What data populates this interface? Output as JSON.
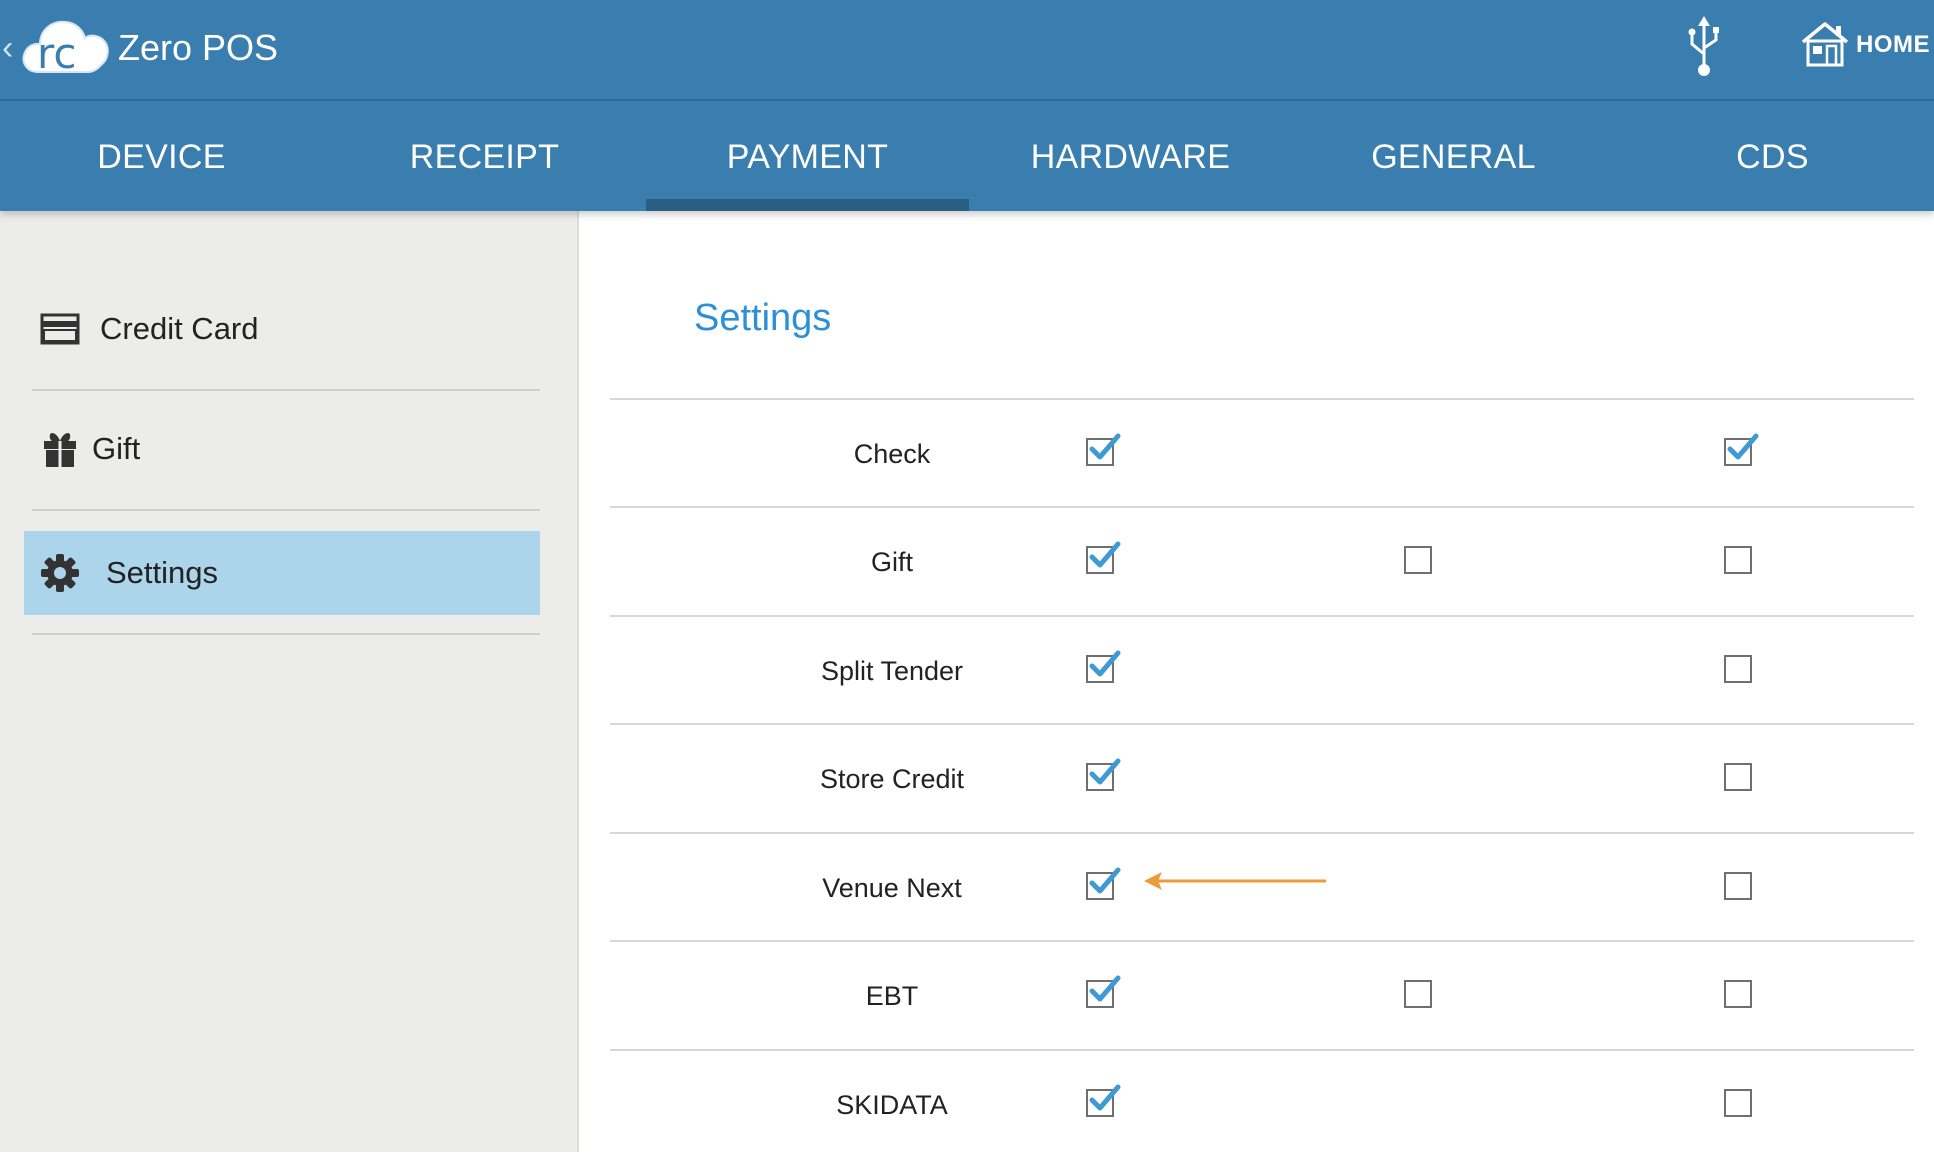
{
  "app": {
    "title": "Zero POS",
    "logo_text": "rc",
    "home_label": "HOME"
  },
  "tabs": [
    {
      "label": "DEVICE",
      "active": false
    },
    {
      "label": "RECEIPT",
      "active": false
    },
    {
      "label": "PAYMENT",
      "active": true
    },
    {
      "label": "HARDWARE",
      "active": false
    },
    {
      "label": "GENERAL",
      "active": false
    },
    {
      "label": "CDS",
      "active": false
    }
  ],
  "sidebar": {
    "items": [
      {
        "label": "Credit Card",
        "icon": "credit-card-icon",
        "selected": false
      },
      {
        "label": "Gift",
        "icon": "gift-icon",
        "selected": false
      },
      {
        "label": "Settings",
        "icon": "gear-icon",
        "selected": true
      }
    ]
  },
  "main": {
    "title": "Settings",
    "rows": [
      {
        "label": "Check",
        "col1": true,
        "col2": null,
        "col3": true
      },
      {
        "label": "Gift",
        "col1": true,
        "col2": false,
        "col3": false
      },
      {
        "label": "Split Tender",
        "col1": true,
        "col2": null,
        "col3": false
      },
      {
        "label": "Store Credit",
        "col1": true,
        "col2": null,
        "col3": false
      },
      {
        "label": "Venue Next",
        "col1": true,
        "col2": null,
        "col3": false
      },
      {
        "label": "EBT",
        "col1": true,
        "col2": false,
        "col3": false
      },
      {
        "label": "SKIDATA",
        "col1": true,
        "col2": null,
        "col3": false
      }
    ],
    "annotation_arrow_row": 4
  },
  "colors": {
    "header": "#3a7eaf",
    "active_tab_indicator": "#2a5f83",
    "sidebar_bg": "#ececea",
    "sidebar_selected": "#acd4ea",
    "title_blue": "#2d8fd6",
    "check_blue": "#3d9ad4",
    "arrow_orange": "#ee9a3a"
  }
}
